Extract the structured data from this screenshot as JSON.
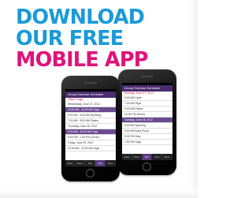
{
  "headline": {
    "line1": "DOWNLOAD",
    "line2": "OUR FREE",
    "line3": "MOBILE APP"
  },
  "colors": {
    "blue": "#1a9ad8",
    "pink": "#e0127a",
    "app_purple": "#4a2c6f"
  },
  "phone_front": {
    "app_title": "Group Exercise Schedule",
    "date": "Class: Yoga",
    "rows": [
      "Wednesday, June 27, 2012",
      "10:00 AM - 11:00 AM  Yoga",
      "5:00 AM - 6:00 AM  Spinning",
      "7:00 AM - 8:00 AM  Pilates",
      "Thursday, June 28, 2012",
      "9:00 AM - 10:00 AM  Yoga",
      "6:00 PM - 7:00 PM  Zumba",
      "Friday, June 29, 2012",
      "10:00 AM - 11:00 AM  Yoga"
    ],
    "tabs": [
      "Class",
      "Room",
      "Instr",
      "Time",
      "More"
    ]
  },
  "phone_back": {
    "app_title": "Group Exercise Schedule",
    "date": "Monday, June 27, 2012",
    "rows": [
      "6:00 AM  Cycle",
      "7:00 AM  Yoga",
      "9:00 AM  Pilates",
      "12:00 PM  Zumba",
      "Tuesday, June 28, 2012",
      "6:00 AM  Spinning",
      "8:00 AM  Body Pump",
      "5:30 PM  Step",
      "7:00 PM  Yoga"
    ],
    "tabs": [
      "Class",
      "Room",
      "Instr",
      "Time",
      "More"
    ]
  }
}
